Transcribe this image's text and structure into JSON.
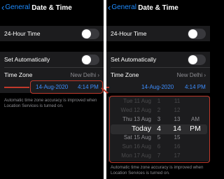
{
  "nav": {
    "back_label": "General",
    "title": "Date & Time"
  },
  "rows": {
    "hour24_label": "24-Hour Time",
    "auto_label": "Set Automatically",
    "timezone_label": "Time Zone",
    "timezone_value": "New Delhi"
  },
  "datetime": {
    "date": "14-Aug-2020",
    "time": "4:14 PM"
  },
  "note": "Automatic time zone accuracy is improved when Location Services is turned on.",
  "picker": {
    "rows": [
      {
        "day": "Tue 11 Aug",
        "hour": "1",
        "minute": "11",
        "ampm": ""
      },
      {
        "day": "Wed 12 Aug",
        "hour": "2",
        "minute": "12",
        "ampm": ""
      },
      {
        "day": "Thu 13 Aug",
        "hour": "3",
        "minute": "13",
        "ampm": "AM"
      },
      {
        "day": "Today",
        "hour": "4",
        "minute": "14",
        "ampm": "PM"
      },
      {
        "day": "Sat 15 Aug",
        "hour": "5",
        "minute": "15",
        "ampm": ""
      },
      {
        "day": "Sun 16 Aug",
        "hour": "6",
        "minute": "16",
        "ampm": ""
      },
      {
        "day": "Mon 17 Aug",
        "hour": "7",
        "minute": "17",
        "ampm": ""
      }
    ]
  },
  "toggles": {
    "hour24_on": false,
    "auto_on": false
  },
  "colors": {
    "accent": "#3d8eff",
    "highlight": "#c0392b"
  }
}
